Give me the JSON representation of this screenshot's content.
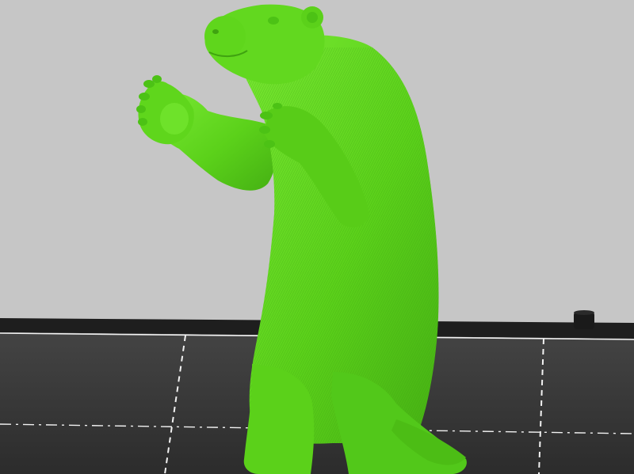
{
  "viewport": {
    "background_color": "#c6c6c6",
    "bed_color": "#3a3a3a",
    "bed_edge_color": "#1e1e1e",
    "grid_line_color": "#f2f2f2",
    "model_color": "#5fd61c",
    "model_highlight_color": "#79ec33",
    "model_shadow_color": "#3fa310"
  },
  "model": {
    "name_icon": "sloth-model-icon"
  }
}
